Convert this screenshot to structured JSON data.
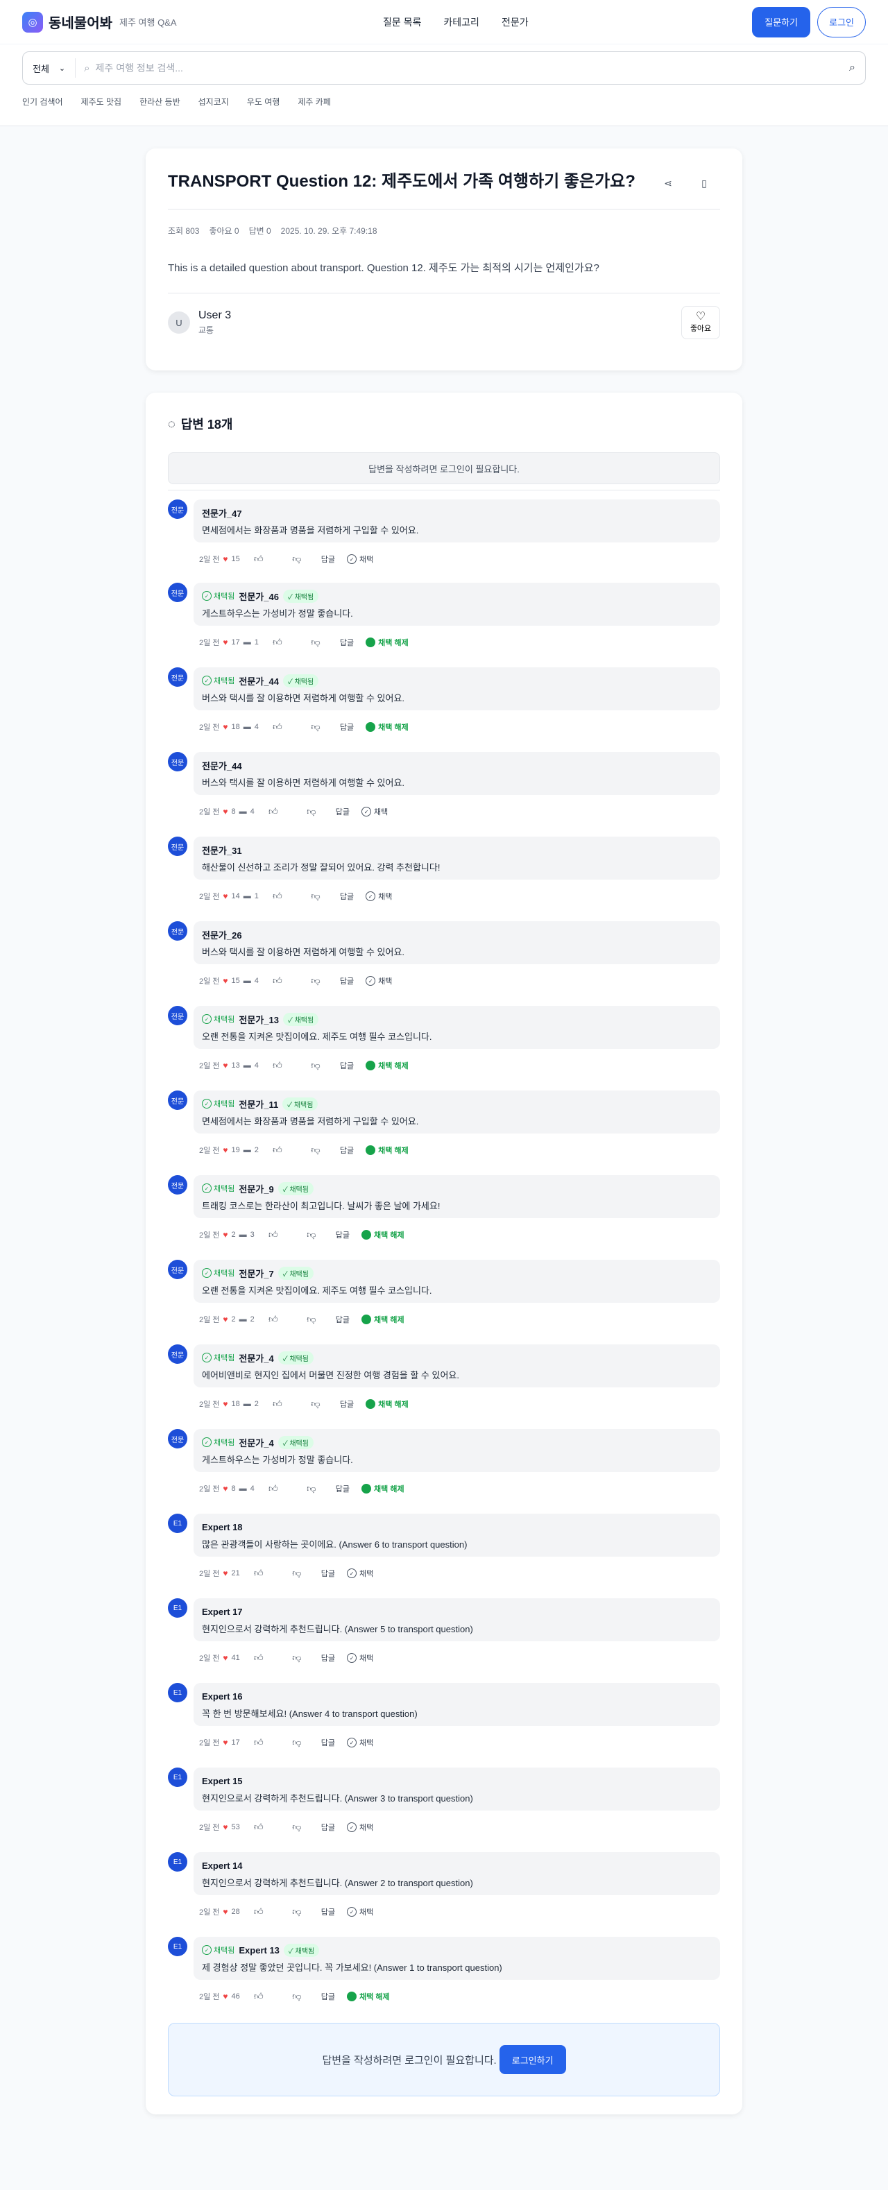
{
  "header": {
    "logo_text": "동네물어봐",
    "subtitle": "제주 여행 Q&A",
    "nav": [
      "질문 목록",
      "카테고리",
      "전문가"
    ],
    "ask_button": "질문하기",
    "login_button": "로그인"
  },
  "search": {
    "select_value": "전체",
    "placeholder": "제주 여행 정보 검색...",
    "popular_tags": [
      "인기 검색어",
      "제주도 맛집",
      "한라산 등반",
      "섭지코지",
      "우도 여행",
      "제주 카페"
    ]
  },
  "question": {
    "title": "TRANSPORT Question 12: 제주도에서 가족 여행하기 좋은가요?",
    "views": "조회 803",
    "likes": "좋아요 0",
    "answers_count": "답변 0",
    "date": "2025. 10. 29. 오후 7:49:18",
    "body": "This is a detailed question about transport. Question 12. 제주도 가는 최적의 시기는 언제인가요?",
    "author_initial": "U",
    "author_name": "User 3",
    "author_category": "교통",
    "like_label": "좋아요"
  },
  "answers_section": {
    "heading": "답변 18개",
    "login_note": "답변을 작성하려면 로그인이 필요합니다.",
    "chosen_label": "채택됨",
    "reply_label": "답글",
    "choose_label": "채택",
    "unchoose_label": "채택 해제",
    "bottom_note": "답변을 작성하려면 로그인이 필요합니다.",
    "bottom_button": "로그인하기"
  },
  "answers": [
    {
      "badge": "전문",
      "name": "전문가_47",
      "text": "면세점에서는 화장품과 명품을 저렴하게 구입할 수 있어요.",
      "time": "2일 전",
      "likes": "15",
      "comments": "",
      "chosen": false
    },
    {
      "badge": "전문",
      "name": "전문가_46",
      "text": "게스트하우스는 가성비가 정말 좋습니다.",
      "time": "2일 전",
      "likes": "17",
      "comments": "1",
      "chosen": true
    },
    {
      "badge": "전문",
      "name": "전문가_44",
      "text": "버스와 택시를 잘 이용하면 저렴하게 여행할 수 있어요.",
      "time": "2일 전",
      "likes": "18",
      "comments": "4",
      "chosen": true
    },
    {
      "badge": "전문",
      "name": "전문가_44",
      "text": "버스와 택시를 잘 이용하면 저렴하게 여행할 수 있어요.",
      "time": "2일 전",
      "likes": "8",
      "comments": "4",
      "chosen": false
    },
    {
      "badge": "전문",
      "name": "전문가_31",
      "text": "해산물이 신선하고 조리가 정말 잘되어 있어요. 강력 추천합니다!",
      "time": "2일 전",
      "likes": "14",
      "comments": "1",
      "chosen": false
    },
    {
      "badge": "전문",
      "name": "전문가_26",
      "text": "버스와 택시를 잘 이용하면 저렴하게 여행할 수 있어요.",
      "time": "2일 전",
      "likes": "15",
      "comments": "4",
      "chosen": false
    },
    {
      "badge": "전문",
      "name": "전문가_13",
      "text": "오랜 전통을 지켜온 맛집이에요. 제주도 여행 필수 코스입니다.",
      "time": "2일 전",
      "likes": "13",
      "comments": "4",
      "chosen": true
    },
    {
      "badge": "전문",
      "name": "전문가_11",
      "text": "면세점에서는 화장품과 명품을 저렴하게 구입할 수 있어요.",
      "time": "2일 전",
      "likes": "19",
      "comments": "2",
      "chosen": true
    },
    {
      "badge": "전문",
      "name": "전문가_9",
      "text": "트래킹 코스로는 한라산이 최고입니다. 날씨가 좋은 날에 가세요!",
      "time": "2일 전",
      "likes": "2",
      "comments": "3",
      "chosen": true
    },
    {
      "badge": "전문",
      "name": "전문가_7",
      "text": "오랜 전통을 지켜온 맛집이에요. 제주도 여행 필수 코스입니다.",
      "time": "2일 전",
      "likes": "2",
      "comments": "2",
      "chosen": true
    },
    {
      "badge": "전문",
      "name": "전문가_4",
      "text": "에어비앤비로 현지인 집에서 머물면 진정한 여행 경험을 할 수 있어요.",
      "time": "2일 전",
      "likes": "18",
      "comments": "2",
      "chosen": true
    },
    {
      "badge": "전문",
      "name": "전문가_4",
      "text": "게스트하우스는 가성비가 정말 좋습니다.",
      "time": "2일 전",
      "likes": "8",
      "comments": "4",
      "chosen": true
    },
    {
      "badge": "E1",
      "name": "Expert 18",
      "text": "많은 관광객들이 사랑하는 곳이에요. (Answer 6 to transport question)",
      "time": "2일 전",
      "likes": "21",
      "comments": "",
      "chosen": false
    },
    {
      "badge": "E1",
      "name": "Expert 17",
      "text": "현지인으로서 강력하게 추천드립니다. (Answer 5 to transport question)",
      "time": "2일 전",
      "likes": "41",
      "comments": "",
      "chosen": false
    },
    {
      "badge": "E1",
      "name": "Expert 16",
      "text": "꼭 한 번 방문해보세요! (Answer 4 to transport question)",
      "time": "2일 전",
      "likes": "17",
      "comments": "",
      "chosen": false
    },
    {
      "badge": "E1",
      "name": "Expert 15",
      "text": "현지인으로서 강력하게 추천드립니다. (Answer 3 to transport question)",
      "time": "2일 전",
      "likes": "53",
      "comments": "",
      "chosen": false
    },
    {
      "badge": "E1",
      "name": "Expert 14",
      "text": "현지인으로서 강력하게 추천드립니다. (Answer 2 to transport question)",
      "time": "2일 전",
      "likes": "28",
      "comments": "",
      "chosen": false
    },
    {
      "badge": "E1",
      "name": "Expert 13",
      "text": "제 경험상 정말 좋았던 곳입니다. 꼭 가보세요! (Answer 1 to transport question)",
      "time": "2일 전",
      "likes": "46",
      "comments": "",
      "chosen": true
    }
  ]
}
